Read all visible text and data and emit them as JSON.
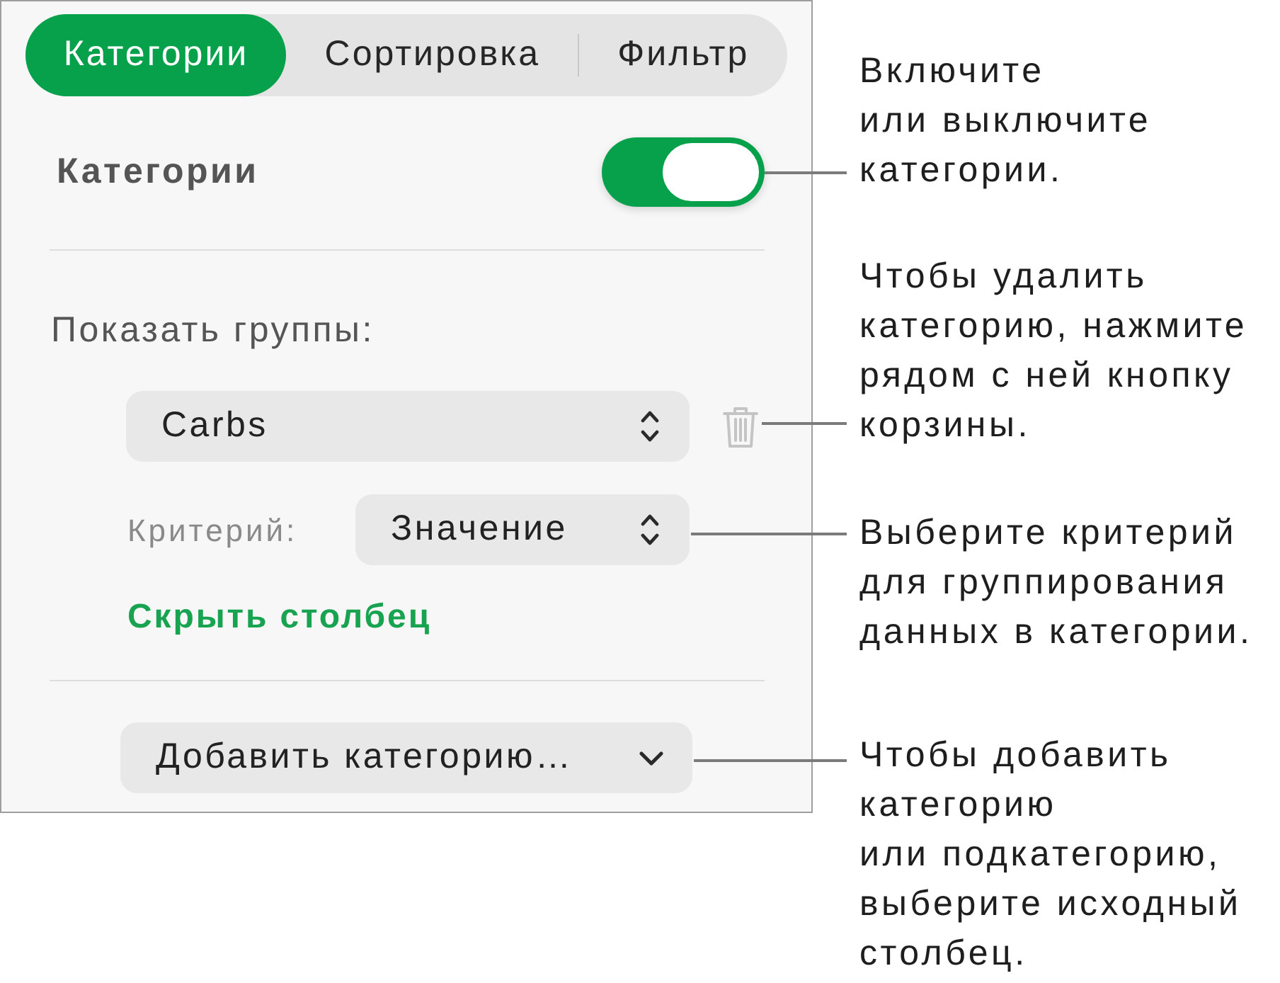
{
  "tabs": [
    {
      "label": "Категории",
      "selected": true
    },
    {
      "label": "Сортировка",
      "selected": false
    },
    {
      "label": "Фильтр",
      "selected": false
    }
  ],
  "categories_toggle": {
    "label": "Категории",
    "on": true
  },
  "groups": {
    "label": "Показать группы:",
    "column_popup": {
      "value": "Carbs"
    },
    "criterion": {
      "label": "Критерий:",
      "value": "Значение"
    },
    "hide_column_link": "Скрыть столбец"
  },
  "add_category_button": {
    "label": "Добавить категорию…"
  },
  "callouts": [
    {
      "text": "Включите\nили выключите\nкатегории."
    },
    {
      "text": "Чтобы удалить\nкатегорию, нажмите\nрядом с ней кнопку\nкорзины."
    },
    {
      "text": "Выберите критерий\nдля группирования\nданных в категории."
    },
    {
      "text": "Чтобы добавить\nкатегорию\nили подкатегорию,\nвыберите исходный\nстолбец."
    }
  ]
}
